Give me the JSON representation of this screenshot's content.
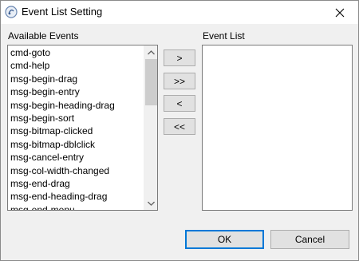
{
  "window": {
    "title": "Event List Setting"
  },
  "available": {
    "label": "Available Events",
    "items": [
      "cmd-goto",
      "cmd-help",
      "msg-begin-drag",
      "msg-begin-entry",
      "msg-begin-heading-drag",
      "msg-begin-sort",
      "msg-bitmap-clicked",
      "msg-bitmap-dblclick",
      "msg-cancel-entry",
      "msg-col-width-changed",
      "msg-end-drag",
      "msg-end-heading-drag",
      "msg-end-menu"
    ]
  },
  "event_list": {
    "label": "Event List",
    "items": []
  },
  "transfer": {
    "add_one": ">",
    "add_all": ">>",
    "remove_one": "<",
    "remove_all": "<<"
  },
  "footer": {
    "ok": "OK",
    "cancel": "Cancel"
  },
  "colors": {
    "accent": "#0078d7",
    "button_bg": "#e1e1e1",
    "scroll_thumb": "#cdcdcd"
  }
}
